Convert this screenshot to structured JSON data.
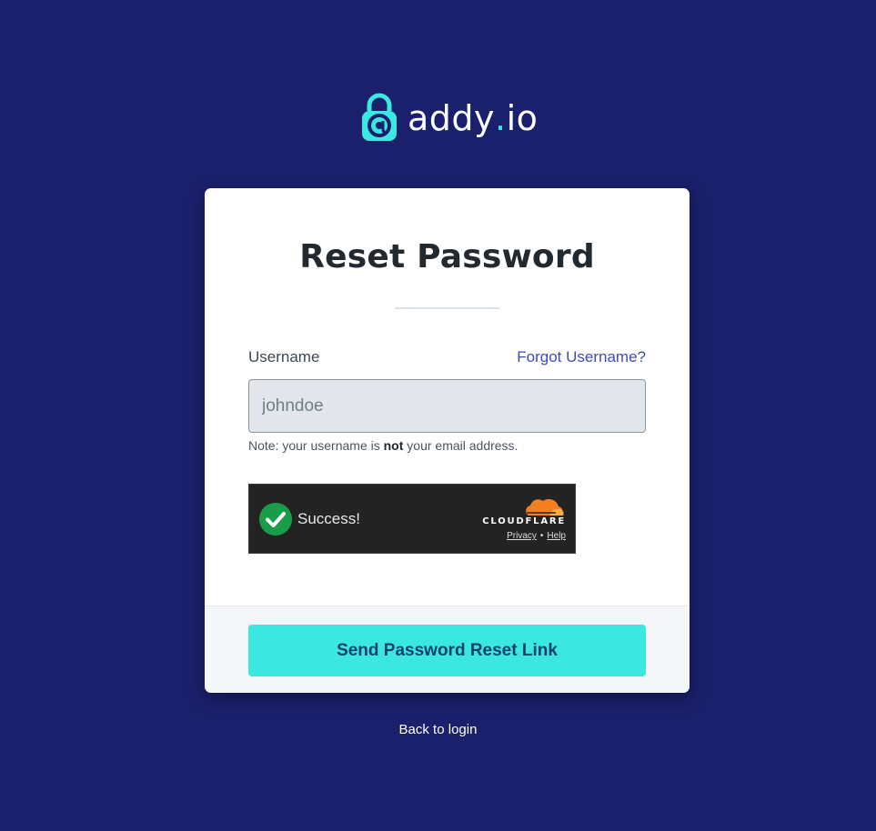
{
  "brand": {
    "icon": "lock-at-icon",
    "name_main": "addy",
    "name_dot": ".",
    "name_tld": "io",
    "accent_color": "#3ae7e1",
    "background_color": "#1a206b"
  },
  "form": {
    "title": "Reset Password",
    "username_label": "Username",
    "forgot_username_link": "Forgot Username?",
    "username_placeholder": "johndoe",
    "username_value": "",
    "note_prefix": "Note: your username is ",
    "note_emphasis": "not",
    "note_suffix": " your email address."
  },
  "captcha": {
    "status_icon": "check-circle-icon",
    "status_text": "Success!",
    "provider_logo": "cloudflare-cloud-icon",
    "provider_name": "CLOUDFLARE",
    "privacy_link": "Privacy",
    "separator": "•",
    "help_link": "Help"
  },
  "actions": {
    "submit_label": "Send Password Reset Link",
    "back_link": "Back to login"
  }
}
